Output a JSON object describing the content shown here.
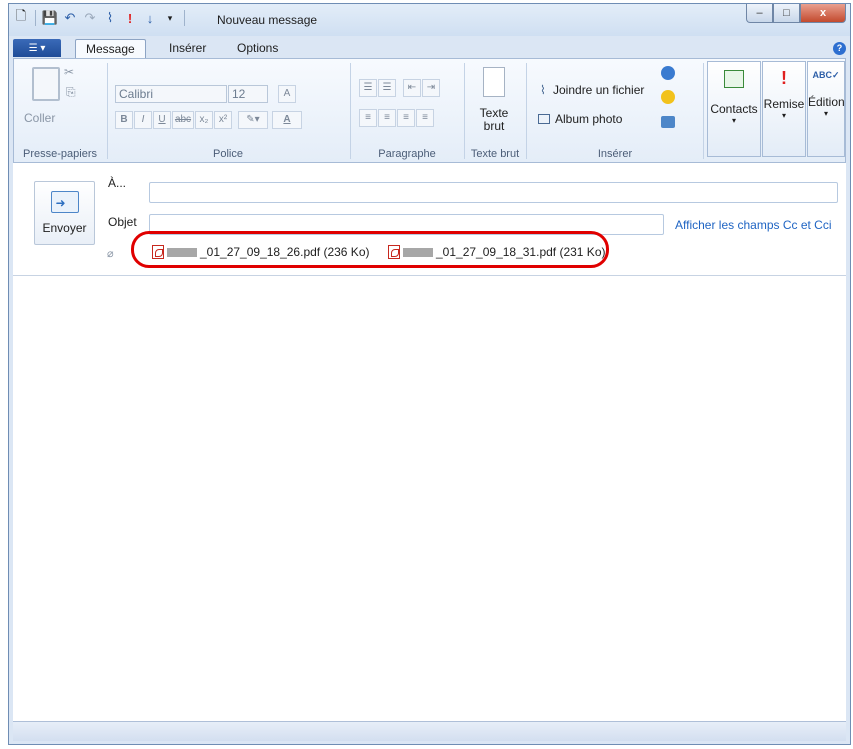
{
  "window": {
    "title": "Nouveau message",
    "controls": {
      "minimize": "–",
      "maximize": "□",
      "close": "x"
    }
  },
  "tabs": [
    "Message",
    "Insérer",
    "Options"
  ],
  "ribbon": {
    "clipboard": {
      "paste": "Coller",
      "label": "Presse-papiers"
    },
    "font": {
      "name": "Calibri",
      "size": "12",
      "label": "Police",
      "bold": "B",
      "italic": "I",
      "underline": "U",
      "strike": "abc",
      "sub": "x₂",
      "sup": "x²",
      "color": "A"
    },
    "paragraph": {
      "label": "Paragraphe"
    },
    "plaintext": {
      "button": "Texte brut",
      "label": "Texte brut"
    },
    "insert": {
      "attach": "Joindre un fichier",
      "album": "Album photo",
      "label": "Insérer"
    },
    "contacts": "Contacts",
    "remise": "Remise",
    "edition": "Édition"
  },
  "compose": {
    "send": "Envoyer",
    "to_label": "À...",
    "subject_label": "Objet",
    "to_value": "",
    "subject_value": "",
    "cc_link": "Afficher les champs Cc et Cci",
    "attachments": [
      {
        "name": "_01_27_09_18_26.pdf (236 Ko)"
      },
      {
        "name": "_01_27_09_18_31.pdf (231 Ko)"
      }
    ]
  },
  "colors": {
    "accent": "#1f64c3",
    "highlight": "#e00000"
  }
}
